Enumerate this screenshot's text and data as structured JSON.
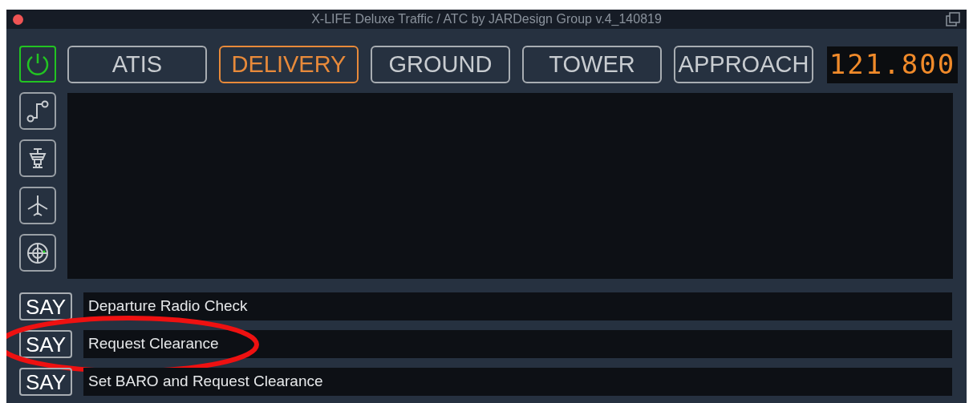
{
  "window": {
    "title": "X-LIFE Deluxe Traffic / ATC by JARDesign Group v.4_140819"
  },
  "power": {
    "on": true
  },
  "tabs": [
    {
      "label": "ATIS",
      "selected": false
    },
    {
      "label": "DELIVERY",
      "selected": true
    },
    {
      "label": "GROUND",
      "selected": false
    },
    {
      "label": "TOWER",
      "selected": false
    },
    {
      "label": "APPROACH",
      "selected": false
    }
  ],
  "frequency": {
    "readout": "121.800"
  },
  "tools": [
    {
      "kind": "route"
    },
    {
      "kind": "tower"
    },
    {
      "kind": "plane"
    },
    {
      "kind": "radar"
    }
  ],
  "phrases": [
    {
      "button": "SAY",
      "text": "Departure Radio Check",
      "highlighted": false
    },
    {
      "button": "SAY",
      "text": "Request Clearance",
      "highlighted": true
    },
    {
      "button": "SAY",
      "text": "Set BARO and Request Clearance",
      "highlighted": false
    }
  ]
}
